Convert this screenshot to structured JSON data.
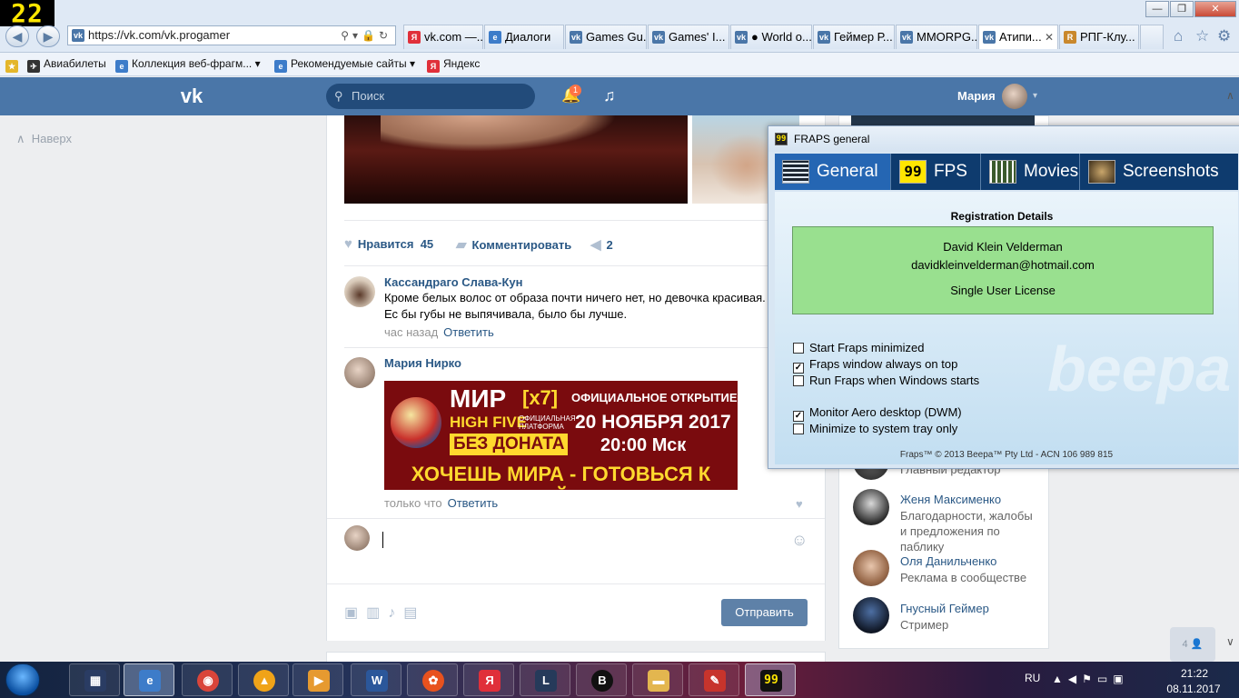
{
  "fraps_counter": "22",
  "browser": {
    "address": "https://vk.com/vk.progamer",
    "tabs": [
      {
        "label": "vk.com —...",
        "icon": "yandex-icon",
        "color": "#e0303a",
        "active": false
      },
      {
        "label": "Диалоги",
        "icon": "ie-icon",
        "color": "#3d7cc9",
        "active": false
      },
      {
        "label": "Games Gu...",
        "icon": "vk-icon",
        "color": "#4a76a8",
        "active": false
      },
      {
        "label": "Games' I...",
        "icon": "vk-icon",
        "color": "#4a76a8",
        "active": false
      },
      {
        "label": "● World o...",
        "icon": "vk-icon",
        "color": "#4a76a8",
        "active": false
      },
      {
        "label": "Геймер Р...",
        "icon": "vk-icon",
        "color": "#4a76a8",
        "active": false
      },
      {
        "label": "MMORPG...",
        "icon": "vk-icon",
        "color": "#4a76a8",
        "active": false
      },
      {
        "label": "Атипи...",
        "icon": "vk-icon",
        "color": "#4a76a8",
        "active": true
      },
      {
        "label": "РПГ-Клу...",
        "icon": "rpg-icon",
        "color": "#c9882c",
        "active": false
      }
    ],
    "favorites": [
      {
        "label": "Авиабилеты",
        "icon": "plane-icon"
      },
      {
        "label": "Коллекция веб-фрагм...",
        "icon": "ie-icon"
      },
      {
        "label": "Рекомендуемые сайты",
        "icon": "ie-icon"
      },
      {
        "label": "Яндекс",
        "icon": "yandex-icon"
      }
    ]
  },
  "vk": {
    "search_placeholder": "Поиск",
    "notifications": "1",
    "user_name": "Мария",
    "back_to_top": "Наверх",
    "post_actions": {
      "like_label": "Нравится",
      "like_count": "45",
      "comment_label": "Комментировать",
      "share_count": "2"
    },
    "comments": [
      {
        "author": "Кассандраго Слава-Кун",
        "text": "Кроме белых волос от образа почти ничего нет, но девочка красивая. Ес бы губы не выпячивала, было бы лучше.",
        "time": "час назад",
        "reply": "Ответить"
      },
      {
        "author": "Мария Нирко",
        "time": "только что",
        "reply": "Ответить"
      }
    ],
    "banner": {
      "mir": "МИР",
      "x7": "[x7]",
      "high_five": "HIGH FIVE",
      "platform": "ОФИЦИАЛЬНАЯ ПЛАТФОРМА",
      "no_donate": "БЕЗ ДОНАТА",
      "official_open": "ОФИЦИАЛЬНОЕ ОТКРЫТИЕ",
      "date": "20 НОЯБРЯ 2017",
      "time": "20:00 Мск",
      "slogan": "ХОЧЕШЬ МИРА - ГОТОВЬСЯ К ВОЙНЕ"
    },
    "send_button": "Отправить",
    "contacts": [
      {
        "name": "",
        "role": "Главный редактор"
      },
      {
        "name": "Женя Максименко",
        "role": "Благодарности, жалобы и предложения по паблику"
      },
      {
        "name": "Оля Данильченко",
        "role": "Реклама в сообществе"
      },
      {
        "name": "Гнусный Геймер",
        "role": "Стример"
      }
    ],
    "online_count": "4"
  },
  "fraps": {
    "title": "FRAPS general",
    "tabs": [
      "General",
      "FPS",
      "Movies",
      "Screenshots"
    ],
    "reg_title": "Registration Details",
    "reg_name": "David Klein Velderman",
    "reg_email": "davidkleinvelderman@hotmail.com",
    "reg_license": "Single User License",
    "options": [
      {
        "label": "Start Fraps minimized",
        "checked": false
      },
      {
        "label": "Fraps window always on top",
        "checked": true
      },
      {
        "label": "Run Fraps when Windows starts",
        "checked": false
      },
      {
        "label": "Monitor Aero desktop (DWM)",
        "checked": true
      },
      {
        "label": "Minimize to system tray only",
        "checked": false
      }
    ],
    "watermark": "beepa",
    "footer": "Fraps™ © 2013 Beepa™ Pty Ltd - ACN 106 989 815"
  },
  "taskbar": {
    "lang": "RU",
    "time": "21:22",
    "date": "08.11.2017"
  },
  "colors": {
    "vk_blue": "#4a76a8",
    "link": "#2a5885",
    "fraps_tab_active": "#2566b3",
    "reg_box": "#99e08f"
  }
}
